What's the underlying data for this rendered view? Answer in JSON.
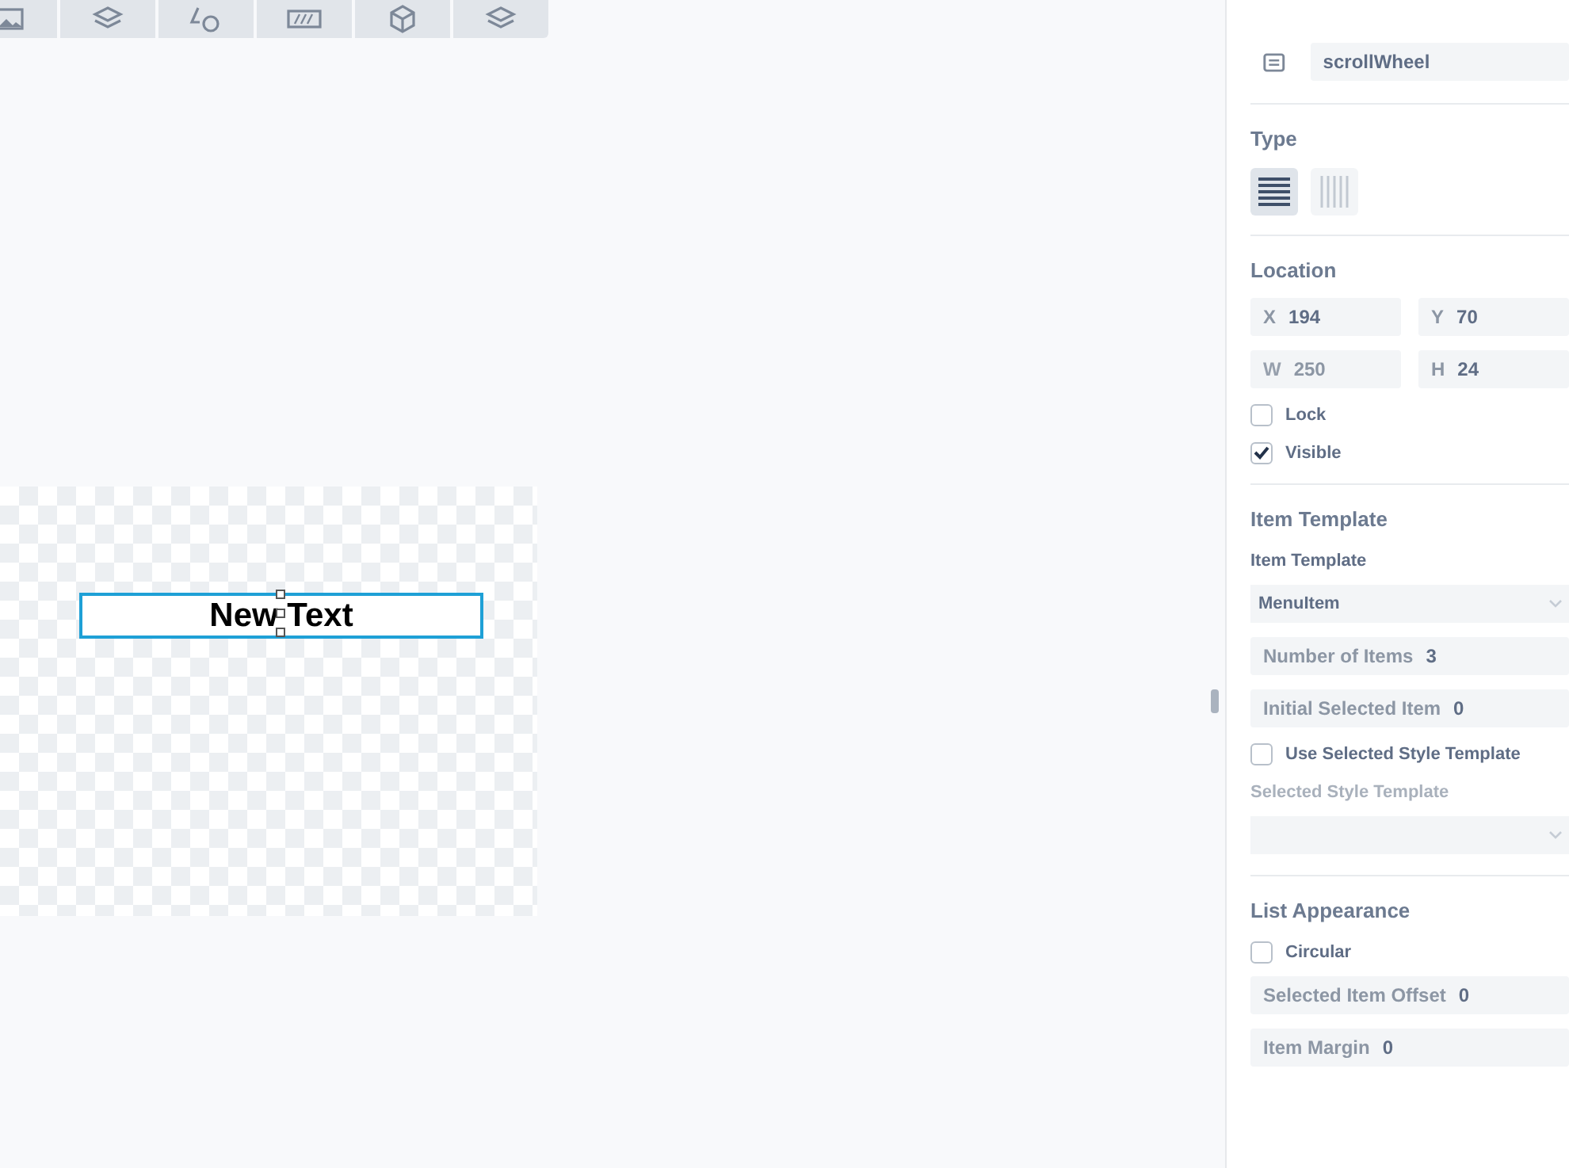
{
  "toolbar": {
    "buttons": [
      {
        "kind": "image"
      },
      {
        "kind": "layers"
      },
      {
        "kind": "shapes"
      },
      {
        "kind": "slider"
      },
      {
        "kind": "cube"
      },
      {
        "kind": "layers"
      }
    ]
  },
  "canvas": {
    "text_element": {
      "text": "New Text",
      "selected": true
    }
  },
  "inspector": {
    "name_field": {
      "value": "scrollWheel"
    },
    "sections": [
      {
        "title": "Type",
        "items": [
          {
            "kind": "toggle",
            "options": [
              {
                "kind": "horizontal",
                "selected": true
              },
              {
                "kind": "vertical",
                "selected": false
              }
            ]
          }
        ]
      },
      {
        "title": "Location",
        "items": [
          {
            "kind": "field_pair",
            "fields": [
              {
                "label": "X",
                "value": "194",
                "disabled": false
              },
              {
                "label": "Y",
                "value": "70",
                "disabled": false
              }
            ]
          },
          {
            "kind": "field_pair",
            "fields": [
              {
                "label": "W",
                "value": "250",
                "disabled": true
              },
              {
                "label": "H",
                "value": "24",
                "disabled": false
              }
            ]
          },
          {
            "kind": "checkbox",
            "label": "Lock",
            "checked": false
          },
          {
            "kind": "checkbox",
            "label": "Visible",
            "checked": true
          }
        ]
      },
      {
        "title": "Item Template",
        "items": [
          {
            "kind": "label",
            "text": "Item Template",
            "disabled": false
          },
          {
            "kind": "select",
            "value": "MenuItem"
          },
          {
            "kind": "field",
            "label": "Number of Items",
            "value": "3"
          },
          {
            "kind": "field",
            "label": "Initial Selected Item",
            "value": "0"
          },
          {
            "kind": "checkbox",
            "label": "Use Selected Style Template",
            "checked": false
          },
          {
            "kind": "label",
            "text": "Selected Style Template",
            "disabled": true
          },
          {
            "kind": "select",
            "value": ""
          }
        ]
      },
      {
        "title": "List Appearance",
        "items": [
          {
            "kind": "checkbox",
            "label": "Circular",
            "checked": false
          },
          {
            "kind": "field",
            "label": "Selected Item Offset",
            "value": "0"
          },
          {
            "kind": "field",
            "label": "Item Margin",
            "value": "0"
          }
        ]
      }
    ]
  }
}
